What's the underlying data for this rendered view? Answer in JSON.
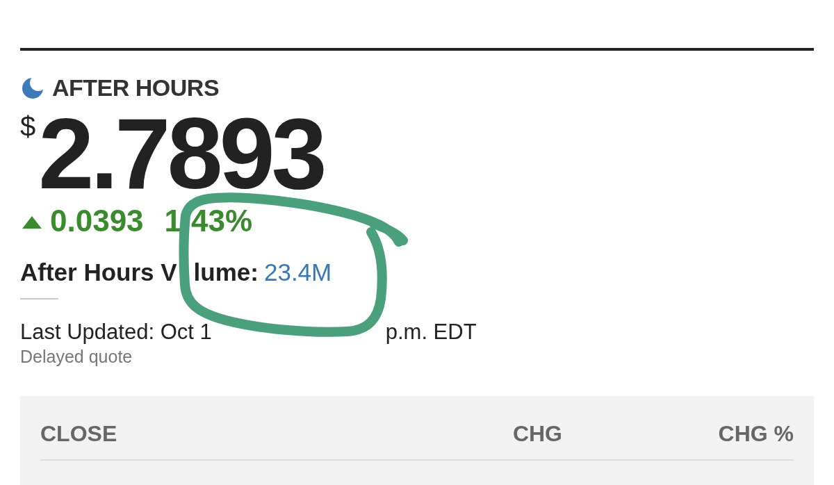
{
  "session": {
    "label": "AFTER HOURS"
  },
  "quote": {
    "currency": "$",
    "price": "2.7893",
    "rising": true,
    "change": "0.0393",
    "change_percent": [
      "1",
      "43%"
    ]
  },
  "volume": {
    "label": [
      "After Hours V",
      "lume:"
    ],
    "value": "23.4M"
  },
  "last_updated": [
    "Last Updated: Oct 1",
    "p.m. EDT"
  ],
  "quote_note": "Delayed quote",
  "table": {
    "columns": [
      "CLOSE",
      "CHG",
      "CHG %"
    ]
  },
  "annotation": {
    "kind": "hand-drawn-circle"
  }
}
